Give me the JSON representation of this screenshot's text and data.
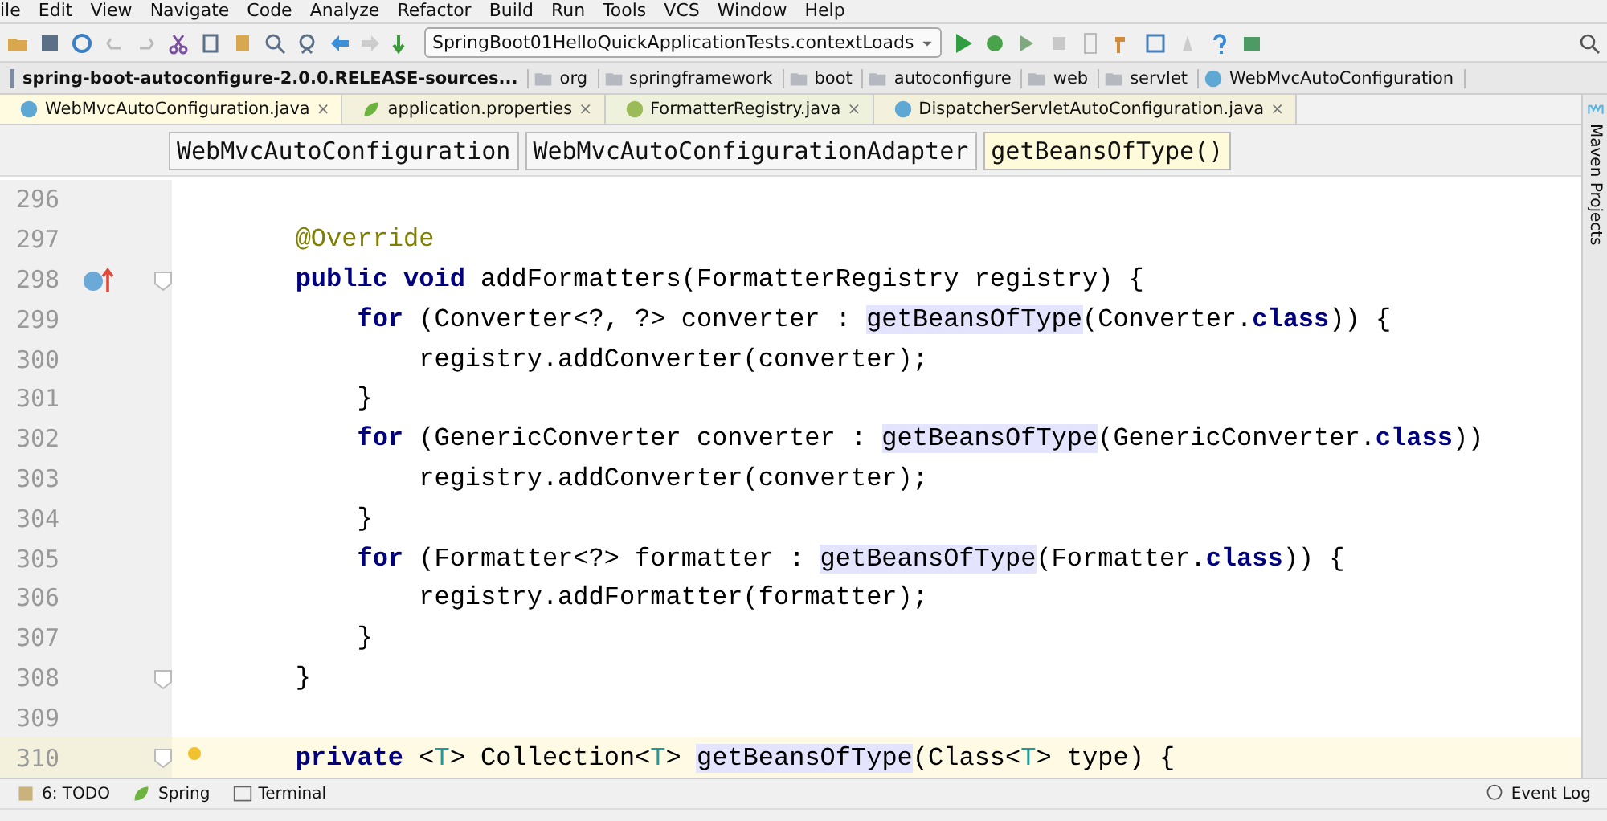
{
  "menu": [
    "ile",
    "Edit",
    "View",
    "Navigate",
    "Code",
    "Analyze",
    "Refactor",
    "Build",
    "Run",
    "Tools",
    "VCS",
    "Window",
    "Help"
  ],
  "toolbar": {
    "run_config": "SpringBoot01HelloQuickApplicationTests.contextLoads"
  },
  "breadcrumbs": [
    {
      "label": "spring-boot-autoconfigure-2.0.0.RELEASE-sources...",
      "kind": "jar"
    },
    {
      "label": "org",
      "kind": "folder"
    },
    {
      "label": "springframework",
      "kind": "folder"
    },
    {
      "label": "boot",
      "kind": "folder"
    },
    {
      "label": "autoconfigure",
      "kind": "folder"
    },
    {
      "label": "web",
      "kind": "folder"
    },
    {
      "label": "servlet",
      "kind": "folder"
    },
    {
      "label": "WebMvcAutoConfiguration",
      "kind": "class"
    }
  ],
  "tabs": [
    {
      "label": "WebMvcAutoConfiguration.java",
      "kind": "class",
      "selected": true,
      "close": "×"
    },
    {
      "label": "application.properties",
      "kind": "props",
      "selected": false,
      "close": "×"
    },
    {
      "label": "FormatterRegistry.java",
      "kind": "interface",
      "selected": false,
      "close": "×"
    },
    {
      "label": "DispatcherServletAutoConfiguration.java",
      "kind": "class",
      "selected": false,
      "close": "×"
    }
  ],
  "structure_path": [
    {
      "label": "WebMvcAutoConfiguration",
      "selected": false
    },
    {
      "label": "WebMvcAutoConfigurationAdapter",
      "selected": false
    },
    {
      "label": "getBeansOfType()",
      "selected": true
    }
  ],
  "code_lines": [
    {
      "number": "296",
      "kind": "plain"
    },
    {
      "number": "297",
      "kind": "plain",
      "tokens": [
        {
          "kind": "annotation",
          "text": "        @Override"
        }
      ]
    },
    {
      "number": "298",
      "kind": "override",
      "fold": true,
      "tokens": [
        {
          "kind": "keyword",
          "text": "        public void "
        },
        {
          "kind": "plain",
          "text": "addFormatters(FormatterRegistry registry) {"
        }
      ]
    },
    {
      "number": "299",
      "kind": "plain",
      "tokens": [
        {
          "kind": "keyword",
          "text": "            for "
        },
        {
          "kind": "plain",
          "text": "(Converter<?, ?> converter : "
        },
        {
          "kind": "usage",
          "text": "getBeansOfType"
        },
        {
          "kind": "plain",
          "text": "(Converter."
        },
        {
          "kind": "keyword",
          "text": "class"
        },
        {
          "kind": "plain",
          "text": ")) {"
        }
      ]
    },
    {
      "number": "300",
      "kind": "plain",
      "tokens": [
        {
          "kind": "plain",
          "text": "                registry.addConverter(converter);"
        }
      ]
    },
    {
      "number": "301",
      "kind": "plain",
      "tokens": [
        {
          "kind": "plain",
          "text": "            }"
        }
      ]
    },
    {
      "number": "302",
      "kind": "plain",
      "tokens": [
        {
          "kind": "keyword",
          "text": "            for "
        },
        {
          "kind": "plain",
          "text": "(GenericConverter converter : "
        },
        {
          "kind": "usage",
          "text": "getBeansOfType"
        },
        {
          "kind": "plain",
          "text": "(GenericConverter."
        },
        {
          "kind": "keyword",
          "text": "class"
        },
        {
          "kind": "plain",
          "text": "))"
        }
      ]
    },
    {
      "number": "303",
      "kind": "plain",
      "tokens": [
        {
          "kind": "plain",
          "text": "                registry.addConverter(converter);"
        }
      ]
    },
    {
      "number": "304",
      "kind": "plain",
      "tokens": [
        {
          "kind": "plain",
          "text": "            }"
        }
      ]
    },
    {
      "number": "305",
      "kind": "plain",
      "tokens": [
        {
          "kind": "keyword",
          "text": "            for "
        },
        {
          "kind": "plain",
          "text": "(Formatter<?> formatter : "
        },
        {
          "kind": "usage",
          "text": "getBeansOfType"
        },
        {
          "kind": "plain",
          "text": "(Formatter."
        },
        {
          "kind": "keyword",
          "text": "class"
        },
        {
          "kind": "plain",
          "text": ")) {"
        }
      ]
    },
    {
      "number": "306",
      "kind": "plain",
      "tokens": [
        {
          "kind": "plain",
          "text": "                registry.addFormatter(formatter);"
        }
      ]
    },
    {
      "number": "307",
      "kind": "plain",
      "tokens": [
        {
          "kind": "plain",
          "text": "            }"
        }
      ]
    },
    {
      "number": "308",
      "kind": "plain",
      "fold": true,
      "tokens": [
        {
          "kind": "plain",
          "text": "        }"
        }
      ]
    },
    {
      "number": "309",
      "kind": "plain"
    },
    {
      "number": "310",
      "kind": "bulb",
      "fold": true,
      "current": true,
      "tokens": [
        {
          "kind": "keyword",
          "text": "        private "
        },
        {
          "kind": "plain",
          "text": "<"
        },
        {
          "kind": "typeparam",
          "text": "T"
        },
        {
          "kind": "plain",
          "text": "> Collection<"
        },
        {
          "kind": "typeparam",
          "text": "T"
        },
        {
          "kind": "plain",
          "text": "> "
        },
        {
          "kind": "usage",
          "text": "getBeansOfType"
        },
        {
          "kind": "plain",
          "text": "(Class<"
        },
        {
          "kind": "typeparam",
          "text": "T"
        },
        {
          "kind": "plain",
          "text": "> type) {"
        }
      ]
    }
  ],
  "right_sidebar": {
    "label": "Maven Projects"
  },
  "tool_windows": [
    {
      "label": "6: TODO",
      "kind": "todo"
    },
    {
      "label": "Spring",
      "kind": "spring"
    },
    {
      "label": "Terminal",
      "kind": "terminal"
    }
  ],
  "event_log": "Event Log"
}
